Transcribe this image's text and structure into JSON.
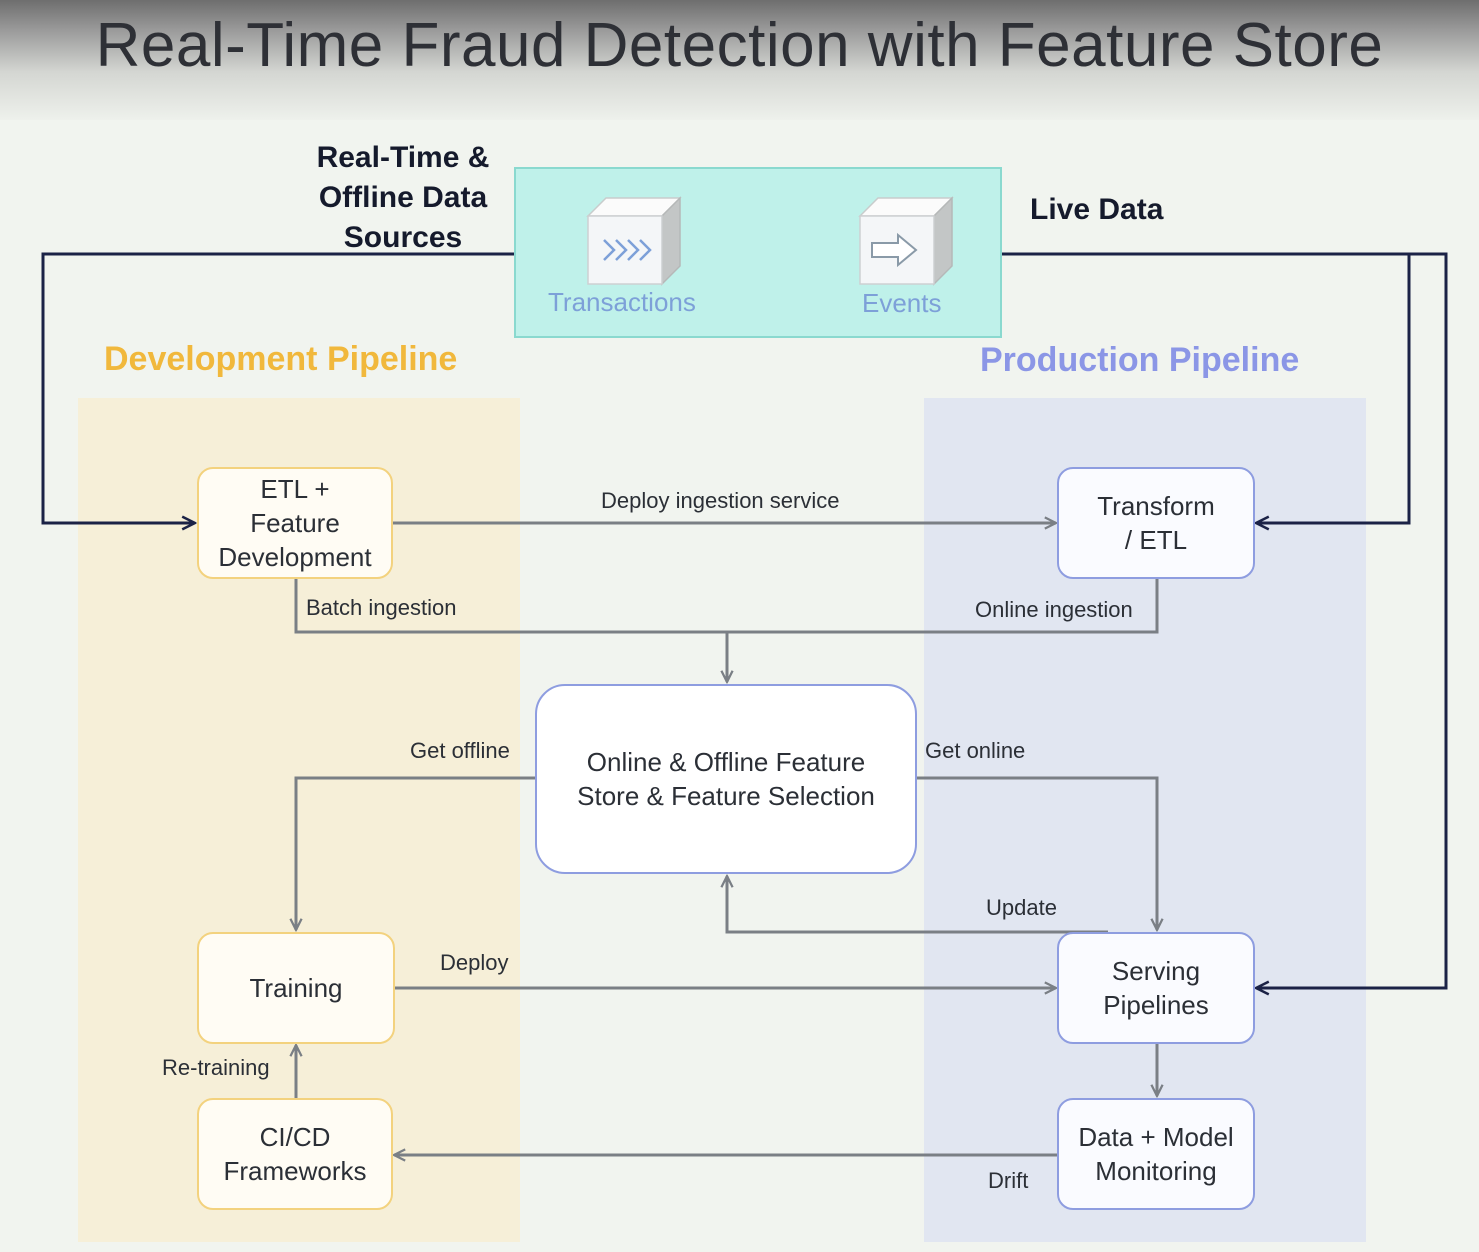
{
  "title": "Real-Time Fraud Detection with Feature Store",
  "sources": {
    "heading": "Real-Time &\nOffline Data\nSources",
    "live_label": "Live Data",
    "items": [
      {
        "label": "Transactions",
        "icon": "chevrons-icon"
      },
      {
        "label": "Events",
        "icon": "arrow-right-icon"
      }
    ]
  },
  "lanes": {
    "development": "Development Pipeline",
    "production": "Production Pipeline"
  },
  "nodes": {
    "etl_feature_dev": "ETL +\nFeature\nDevelopment",
    "transform_etl": "Transform\n/ ETL",
    "feature_store": "Online & Offline Feature\nStore & Feature Selection",
    "training": "Training",
    "serving": "Serving\nPipelines",
    "cicd": "CI/CD\nFrameworks",
    "monitoring": "Data + Model\nMonitoring"
  },
  "edges": {
    "deploy_ingestion": "Deploy ingestion service",
    "batch_ingestion": "Batch ingestion",
    "online_ingestion": "Online ingestion",
    "get_offline": "Get offline",
    "get_online": "Get online",
    "update": "Update",
    "deploy": "Deploy",
    "retraining": "Re-training",
    "drift": "Drift"
  },
  "colors": {
    "dev_accent": "#f1b83c",
    "prod_accent": "#8b96e6",
    "sources_fill": "#bff1ea",
    "live_wire": "#1b2246",
    "internal_wire": "#7a7f85"
  }
}
